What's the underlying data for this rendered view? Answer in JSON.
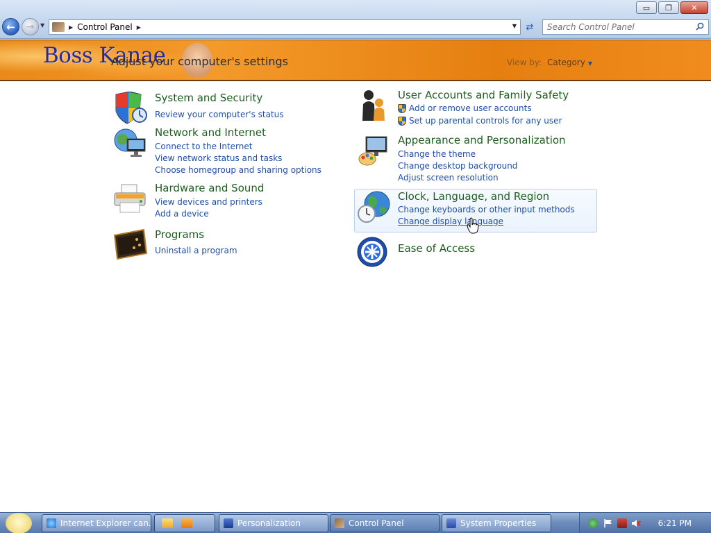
{
  "window": {
    "title_buttons": {
      "minimize": "▭",
      "restore": "❐",
      "close": "✕"
    }
  },
  "nav": {
    "breadcrumb": "Control Panel",
    "search_placeholder": "Search Control Panel"
  },
  "banner": {
    "logo_text": "Boss Kanae",
    "heading": "Adjust your computer's settings",
    "view_by_label": "View by:",
    "view_by_value": "Category"
  },
  "categories_left": [
    {
      "title": "System and Security",
      "links": [
        "Review your computer's status"
      ]
    },
    {
      "title": "Network and Internet",
      "links": [
        "Connect to the Internet",
        "View network status and tasks",
        "Choose homegroup and sharing options"
      ]
    },
    {
      "title": "Hardware and Sound",
      "links": [
        "View devices and printers",
        "Add a device"
      ]
    },
    {
      "title": "Programs",
      "links": [
        "Uninstall a program"
      ]
    }
  ],
  "categories_right": [
    {
      "title": "User Accounts and Family Safety",
      "links": [
        "Add or remove user accounts",
        "Set up parental controls for any user"
      ]
    },
    {
      "title": "Appearance and Personalization",
      "links": [
        "Change the theme",
        "Change desktop background",
        "Adjust screen resolution"
      ]
    },
    {
      "title": "Clock, Language, and Region",
      "links": [
        "Change keyboards or other input methods",
        "Change display language"
      ]
    },
    {
      "title": "Ease of Access",
      "links": []
    }
  ],
  "taskbar": {
    "buttons": [
      "Internet Explorer can...",
      "Personalization",
      "Control Panel",
      "System Properties"
    ],
    "clock": "6:21 PM"
  },
  "colors": {
    "category_title": "#1e5d20",
    "link": "#1f4ea8",
    "banner": "#e98a1a"
  }
}
